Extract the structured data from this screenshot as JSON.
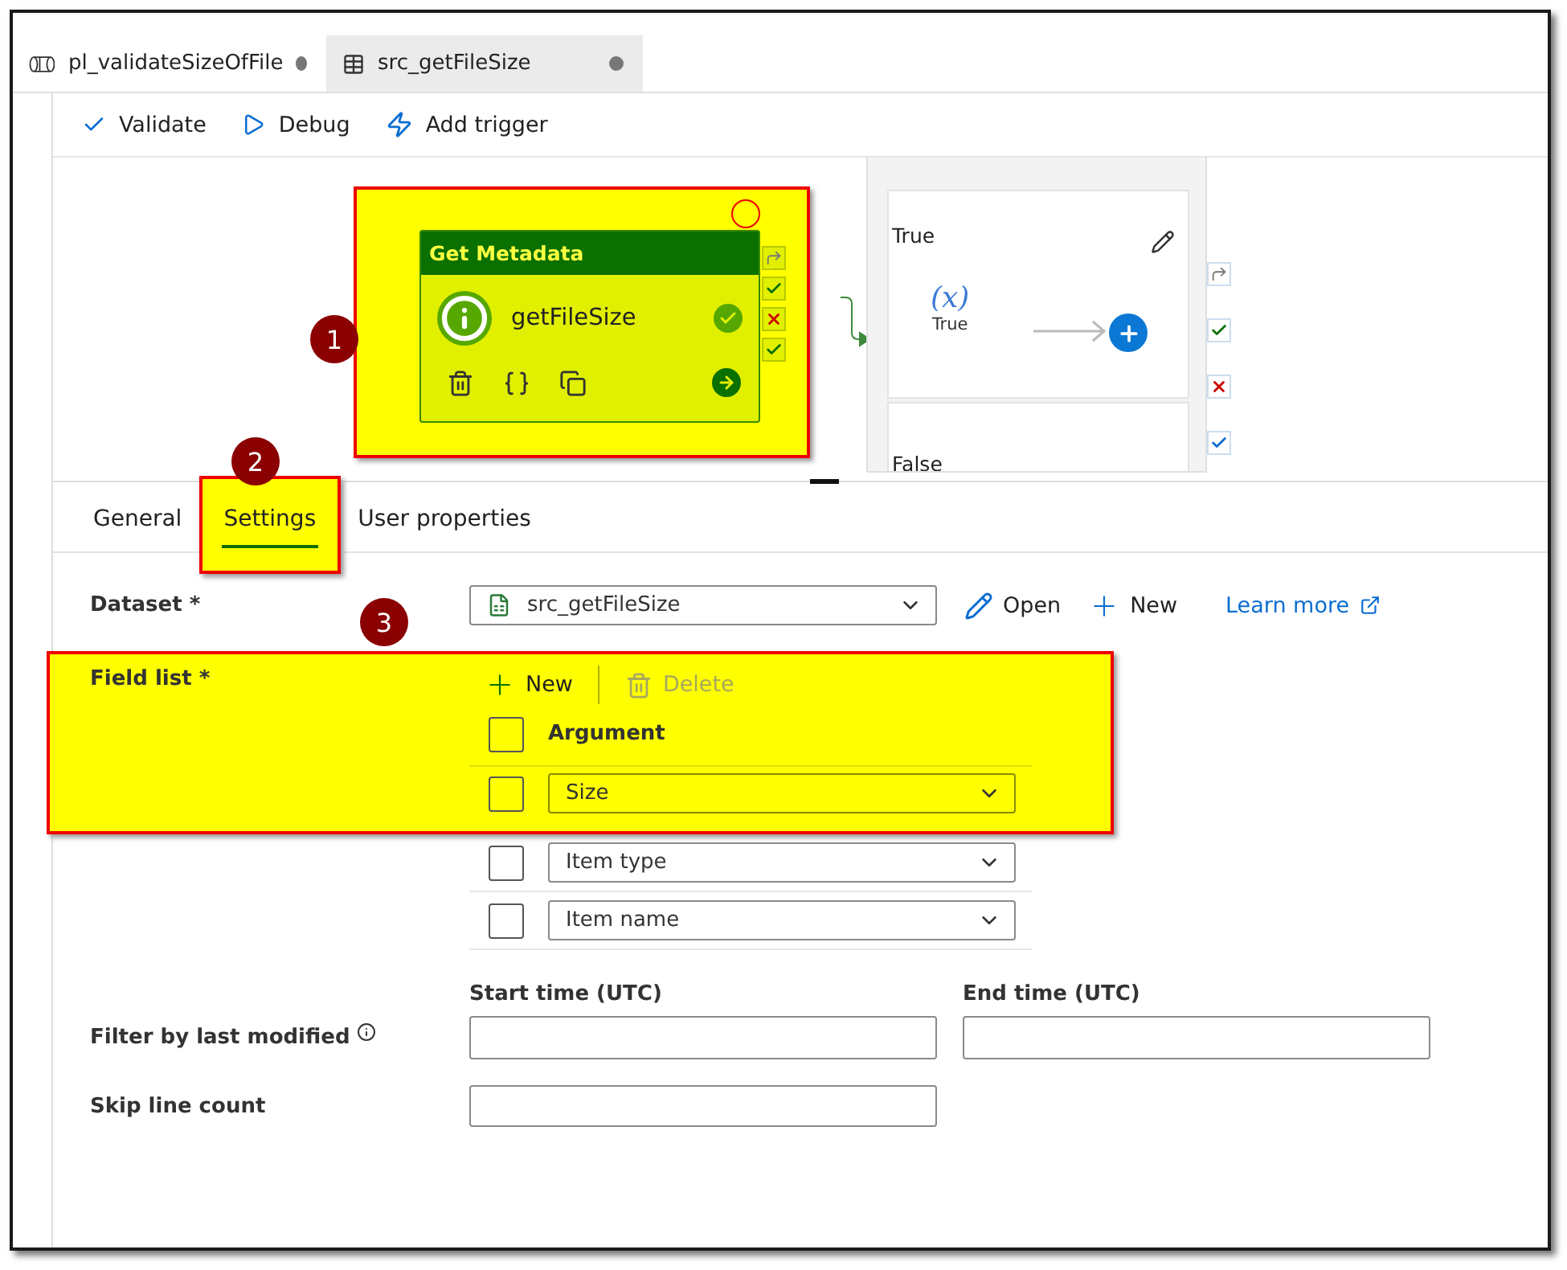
{
  "file_tabs": [
    {
      "label": "pl_validateSizeOfFile",
      "kind": "pipeline",
      "selected": true,
      "unsaved": true
    },
    {
      "label": "src_getFileSize",
      "kind": "dataset",
      "selected": false,
      "unsaved": true
    }
  ],
  "toolbar": [
    {
      "label": "Validate",
      "kind": "check"
    },
    {
      "label": "Debug",
      "kind": "play"
    },
    {
      "label": "Add trigger",
      "kind": "trigger"
    }
  ],
  "canvas": {
    "activity": {
      "type": "Get Metadata",
      "name": "getFileSize",
      "highlighted": true
    },
    "if_branch": {
      "true_case": {
        "title": "True",
        "variable": "(x)",
        "variable_label": "True"
      },
      "false_case": {
        "title": "False"
      }
    }
  },
  "annotations": [
    {
      "label": "1"
    },
    {
      "label": "2"
    },
    {
      "label": "3"
    }
  ],
  "panel_tabs": [
    {
      "label": "General",
      "selected": false,
      "highlighted": false
    },
    {
      "label": "Settings",
      "selected": true,
      "highlighted": true
    },
    {
      "label": "User properties",
      "selected": false,
      "highlighted": false
    }
  ],
  "dataset": {
    "label": "Dataset *",
    "value": "src_getFileSize",
    "actions": [
      {
        "label": "Open",
        "kind": "edit"
      },
      {
        "label": "New",
        "kind": "add"
      },
      {
        "label": "Learn more",
        "kind": "link"
      }
    ]
  },
  "field_list": {
    "label": "Field list *",
    "highlighted": true,
    "actions": [
      {
        "label": "New",
        "kind": "add",
        "disabled": false
      },
      {
        "label": "Delete",
        "kind": "delete",
        "disabled": true
      }
    ],
    "header": "Argument",
    "header_checked": false,
    "rows": [
      {
        "value": "Size",
        "checked": false,
        "highlighted": true
      },
      {
        "value": "Item type",
        "checked": false,
        "highlighted": false
      },
      {
        "value": "Item name",
        "checked": false,
        "highlighted": false
      }
    ]
  },
  "filter": {
    "label": "Filter by last modified",
    "start_label": "Start time (UTC)",
    "end_label": "End time (UTC)"
  },
  "skip_line_count": {
    "label": "Skip line count"
  }
}
